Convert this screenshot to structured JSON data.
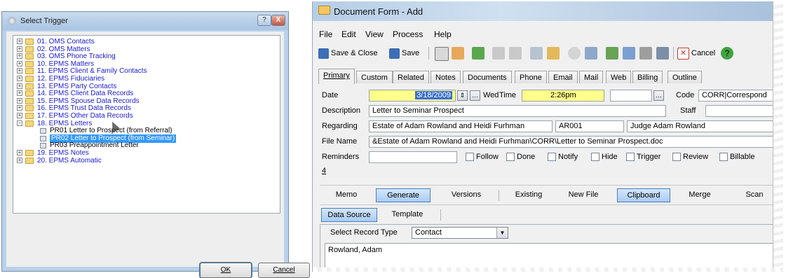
{
  "trigger_dialog": {
    "title": "Select Trigger",
    "items": [
      {
        "label": "01. OMS Contacts",
        "expander": "+"
      },
      {
        "label": "02. OMS Matters",
        "expander": "+"
      },
      {
        "label": "03. OMS Phone Tracking",
        "expander": "+"
      },
      {
        "label": "10. EPMS Matters",
        "expander": "+"
      },
      {
        "label": "11. EPMS Client & Family Contacts",
        "expander": "+"
      },
      {
        "label": "12. EPMS Fiduciaries",
        "expander": "+"
      },
      {
        "label": "13. EPMS Party Contacts",
        "expander": "+"
      },
      {
        "label": "14. EPMS Client Data Records",
        "expander": "+"
      },
      {
        "label": "15. EPMS Spouse Data Records",
        "expander": "+"
      },
      {
        "label": "16. EPMS Trust Data Records",
        "expander": "+"
      },
      {
        "label": "17. EPMS Other Data Records",
        "expander": "+"
      },
      {
        "label": "18. EPMS Letters",
        "expander": "−"
      },
      {
        "label": "PR01 Letter to Prospect (from Referral)",
        "child": true
      },
      {
        "label": "PR02 Letter to Prospect (from Seminar)",
        "child": true,
        "selected": true
      },
      {
        "label": "PR03 Preappointment Letter",
        "child": true
      },
      {
        "label": "19. EPMS Notes",
        "expander": "+"
      },
      {
        "label": "20. EPMS Automatic",
        "expander": "+"
      }
    ],
    "ok_label": "OK",
    "cancel_label": "Cancel",
    "help_label": "?",
    "close_label": "X"
  },
  "doc_form": {
    "title": "Document Form - Add",
    "menu": [
      "File",
      "Edit",
      "View",
      "Process",
      "Help"
    ],
    "toolbar": {
      "save_close": "Save & Close",
      "save": "Save",
      "cancel": "Cancel"
    },
    "tabs": [
      "Primary",
      "Custom",
      "Related",
      "Notes",
      "Documents",
      "Phone",
      "Email",
      "Mail",
      "Web",
      "Billing",
      "Outline"
    ],
    "fields": {
      "date_label": "Date",
      "date_value": "3/18/2009",
      "day": "Wed",
      "time_label": "Time",
      "time_value": "2:26pm",
      "code_label": "Code",
      "code_value": "CORR|Correspond",
      "description_label": "Description",
      "description_value": "Letter to Seminar Prospect",
      "staff_label": "Staff",
      "regarding_label": "Regarding",
      "regarding_value": "Estate of Adam Rowland and Heidi Furhman",
      "regarding_code": "AR001",
      "regarding_judge": "Judge Adam Rowland",
      "filename_label": "File Name",
      "filename_value": "&Estate of Adam Rowland and Heidi Furhman\\CORR\\Letter to Seminar Prospect.doc",
      "reminders_label": "Reminders",
      "checkboxes": [
        "Follow",
        "Done",
        "Notify",
        "Hide",
        "Trigger",
        "Review",
        "Billable"
      ],
      "row_number": "4"
    },
    "sub_buttons": [
      "Memo",
      "Generate",
      "Versions",
      "Existing",
      "New File",
      "Clipboard",
      "Merge",
      "Scan"
    ],
    "source_tabs": [
      "Data Source",
      "Template"
    ],
    "record_type_label": "Select Record Type",
    "record_type_value": "Contact",
    "record_list": [
      "Rowland, Adam"
    ]
  }
}
